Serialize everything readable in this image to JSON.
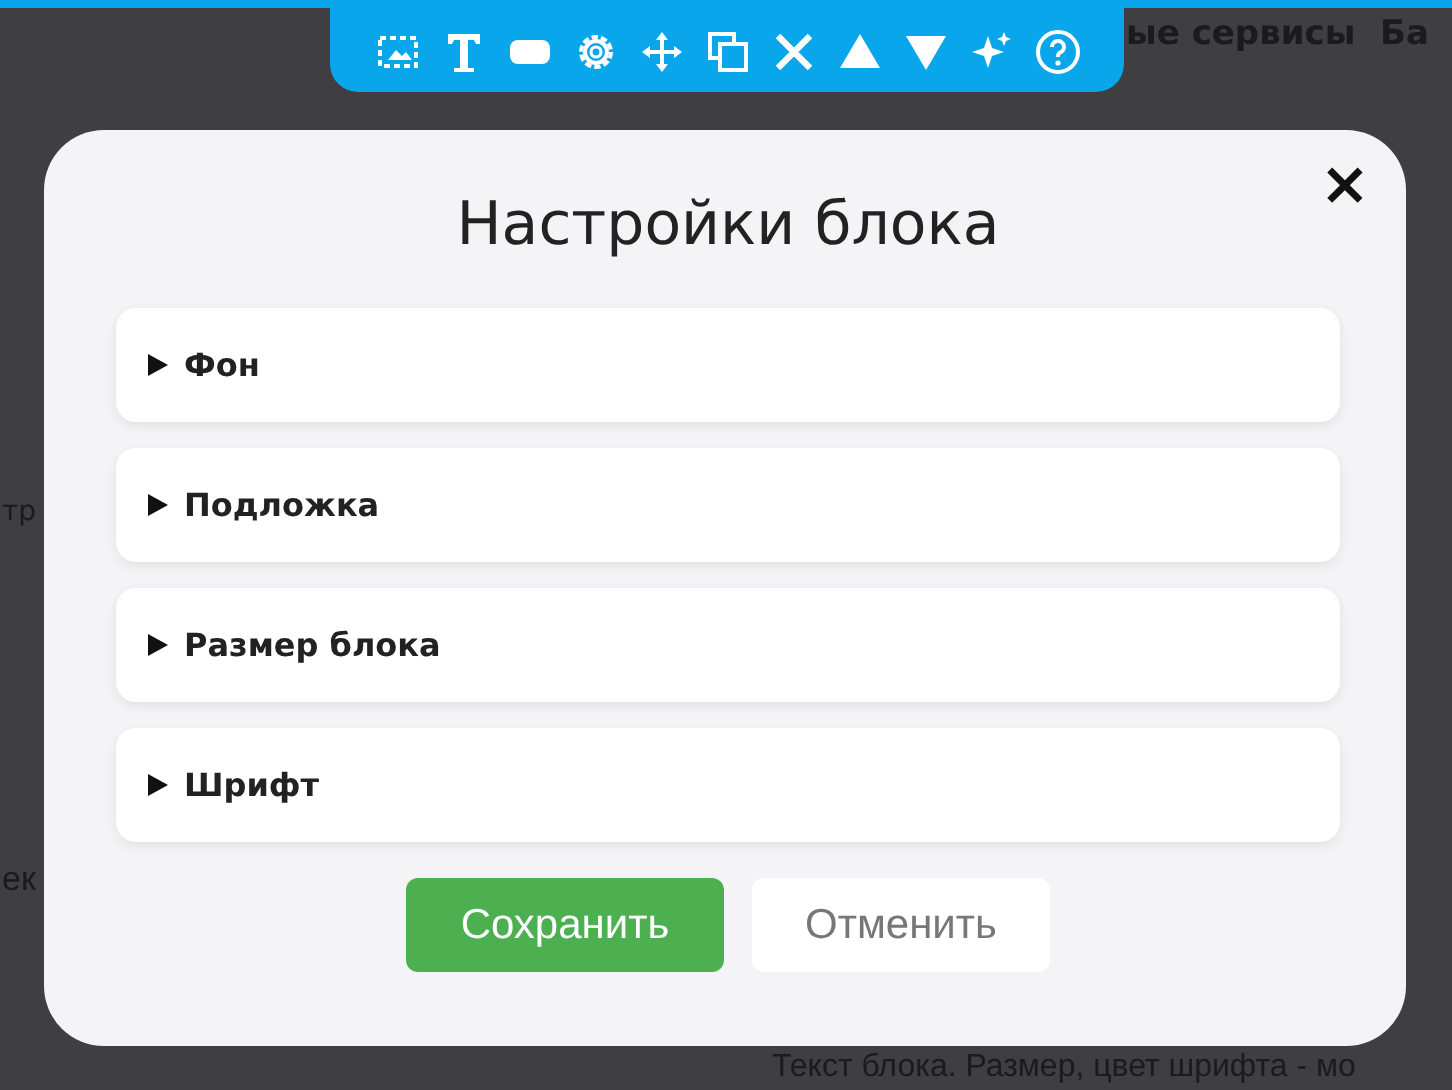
{
  "background_page": {
    "nav_texts": [
      "ые сервисы",
      "Ба"
    ],
    "side_texts": [
      "тр",
      "ек"
    ],
    "body_text": "Текст блока. Размер, цвет шрифта - мо"
  },
  "dialog": {
    "title": "Настройки блока",
    "close": "×",
    "sections": [
      {
        "label": "Фон",
        "expanded": false
      },
      {
        "label": "Подложка",
        "expanded": false
      },
      {
        "label": "Размер блока",
        "expanded": false
      },
      {
        "label": "Шрифт",
        "expanded": false
      }
    ],
    "buttons": [
      {
        "label": "Сохранить",
        "kind": "primary"
      },
      {
        "label": "Отменить",
        "kind": "secondary"
      }
    ]
  }
}
